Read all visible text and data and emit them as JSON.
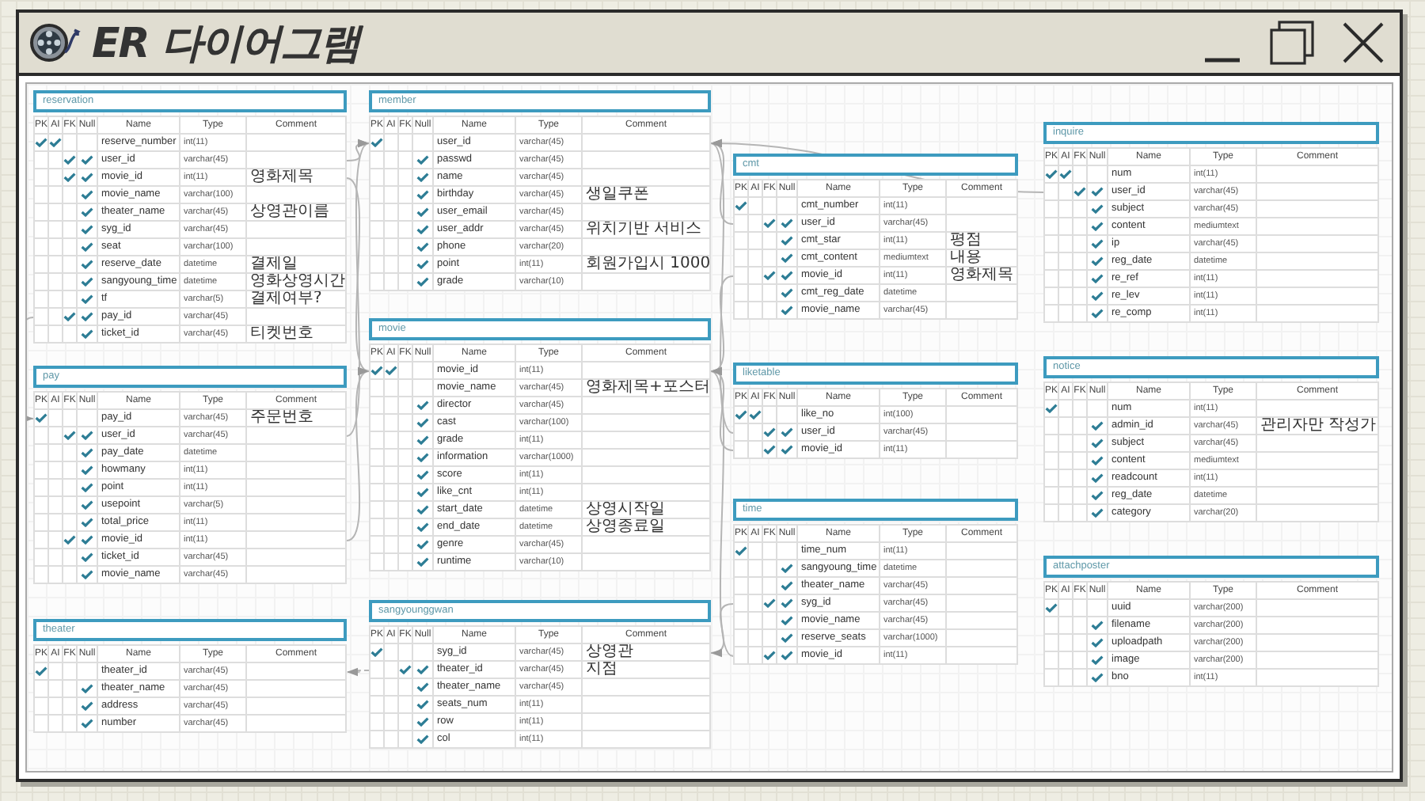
{
  "window": {
    "title": "ER 다이어그램"
  },
  "tables": [
    {
      "name": "reservation",
      "columns": [
        "PK",
        "AI",
        "FK",
        "Null",
        "Name",
        "Type",
        "Comment"
      ],
      "rows": [
        {
          "pk": true,
          "ai": true,
          "fk": false,
          "nn": false,
          "name": "reserve_number",
          "type": "int(11)"
        },
        {
          "pk": false,
          "ai": false,
          "fk": true,
          "nn": true,
          "name": "user_id",
          "type": "varchar(45)"
        },
        {
          "pk": false,
          "ai": false,
          "fk": true,
          "nn": true,
          "name": "movie_id",
          "type": "int(11)",
          "comment": "영화제목"
        },
        {
          "pk": false,
          "ai": false,
          "fk": false,
          "nn": true,
          "name": "movie_name",
          "type": "varchar(100)"
        },
        {
          "pk": false,
          "ai": false,
          "fk": false,
          "nn": true,
          "name": "theater_name",
          "type": "varchar(45)",
          "comment": "상영관이름"
        },
        {
          "pk": false,
          "ai": false,
          "fk": false,
          "nn": true,
          "name": "syg_id",
          "type": "varchar(45)"
        },
        {
          "pk": false,
          "ai": false,
          "fk": false,
          "nn": true,
          "name": "seat",
          "type": "varchar(100)"
        },
        {
          "pk": false,
          "ai": false,
          "fk": false,
          "nn": true,
          "name": "reserve_date",
          "type": "datetime",
          "comment": "결제일"
        },
        {
          "pk": false,
          "ai": false,
          "fk": false,
          "nn": true,
          "name": "sangyoung_time",
          "type": "datetime",
          "comment": "영화상영시간"
        },
        {
          "pk": false,
          "ai": false,
          "fk": false,
          "nn": true,
          "name": "tf",
          "type": "varchar(5)",
          "comment": "결제여부?"
        },
        {
          "pk": false,
          "ai": false,
          "fk": true,
          "nn": true,
          "name": "pay_id",
          "type": "varchar(45)"
        },
        {
          "pk": false,
          "ai": false,
          "fk": false,
          "nn": true,
          "name": "ticket_id",
          "type": "varchar(45)",
          "comment": "티켓번호"
        }
      ]
    },
    {
      "name": "pay",
      "columns": [
        "PK",
        "AI",
        "FK",
        "Null",
        "Name",
        "Type",
        "Comment"
      ],
      "rows": [
        {
          "pk": true,
          "ai": false,
          "fk": false,
          "nn": false,
          "name": "pay_id",
          "type": "varchar(45)",
          "comment": "주문번호"
        },
        {
          "pk": false,
          "ai": false,
          "fk": true,
          "nn": true,
          "name": "user_id",
          "type": "varchar(45)"
        },
        {
          "pk": false,
          "ai": false,
          "fk": false,
          "nn": true,
          "name": "pay_date",
          "type": "datetime"
        },
        {
          "pk": false,
          "ai": false,
          "fk": false,
          "nn": true,
          "name": "howmany",
          "type": "int(11)"
        },
        {
          "pk": false,
          "ai": false,
          "fk": false,
          "nn": true,
          "name": "point",
          "type": "int(11)"
        },
        {
          "pk": false,
          "ai": false,
          "fk": false,
          "nn": true,
          "name": "usepoint",
          "type": "varchar(5)"
        },
        {
          "pk": false,
          "ai": false,
          "fk": false,
          "nn": true,
          "name": "total_price",
          "type": "int(11)"
        },
        {
          "pk": false,
          "ai": false,
          "fk": true,
          "nn": true,
          "name": "movie_id",
          "type": "int(11)"
        },
        {
          "pk": false,
          "ai": false,
          "fk": false,
          "nn": true,
          "name": "ticket_id",
          "type": "varchar(45)"
        },
        {
          "pk": false,
          "ai": false,
          "fk": false,
          "nn": true,
          "name": "movie_name",
          "type": "varchar(45)"
        }
      ]
    },
    {
      "name": "theater",
      "columns": [
        "PK",
        "AI",
        "FK",
        "Null",
        "Name",
        "Type",
        "Comment"
      ],
      "rows": [
        {
          "pk": true,
          "ai": false,
          "fk": false,
          "nn": false,
          "name": "theater_id",
          "type": "varchar(45)"
        },
        {
          "pk": false,
          "ai": false,
          "fk": false,
          "nn": true,
          "name": "theater_name",
          "type": "varchar(45)"
        },
        {
          "pk": false,
          "ai": false,
          "fk": false,
          "nn": true,
          "name": "address",
          "type": "varchar(45)"
        },
        {
          "pk": false,
          "ai": false,
          "fk": false,
          "nn": true,
          "name": "number",
          "type": "varchar(45)"
        }
      ]
    },
    {
      "name": "member",
      "columns": [
        "PK",
        "AI",
        "FK",
        "Null",
        "Name",
        "Type",
        "Comment"
      ],
      "rows": [
        {
          "pk": true,
          "ai": false,
          "fk": false,
          "nn": false,
          "name": "user_id",
          "type": "varchar(45)"
        },
        {
          "pk": false,
          "ai": false,
          "fk": false,
          "nn": true,
          "name": "passwd",
          "type": "varchar(45)"
        },
        {
          "pk": false,
          "ai": false,
          "fk": false,
          "nn": true,
          "name": "name",
          "type": "varchar(45)"
        },
        {
          "pk": false,
          "ai": false,
          "fk": false,
          "nn": true,
          "name": "birthday",
          "type": "varchar(45)",
          "comment": "생일쿠폰"
        },
        {
          "pk": false,
          "ai": false,
          "fk": false,
          "nn": true,
          "name": "user_email",
          "type": "varchar(45)"
        },
        {
          "pk": false,
          "ai": false,
          "fk": false,
          "nn": true,
          "name": "user_addr",
          "type": "varchar(45)",
          "comment": "위치기반 서비스"
        },
        {
          "pk": false,
          "ai": false,
          "fk": false,
          "nn": true,
          "name": "phone",
          "type": "varchar(20)"
        },
        {
          "pk": false,
          "ai": false,
          "fk": false,
          "nn": true,
          "name": "point",
          "type": "int(11)",
          "comment": "회원가입시 1000"
        },
        {
          "pk": false,
          "ai": false,
          "fk": false,
          "nn": true,
          "name": "grade",
          "type": "varchar(10)"
        }
      ]
    },
    {
      "name": "movie",
      "columns": [
        "PK",
        "AI",
        "FK",
        "Null",
        "Name",
        "Type",
        "Comment"
      ],
      "rows": [
        {
          "pk": true,
          "ai": true,
          "fk": false,
          "nn": false,
          "name": "movie_id",
          "type": "int(11)"
        },
        {
          "pk": false,
          "ai": false,
          "fk": false,
          "nn": false,
          "name": "movie_name",
          "type": "varchar(45)",
          "comment": "영화제목+포스터"
        },
        {
          "pk": false,
          "ai": false,
          "fk": false,
          "nn": true,
          "name": "director",
          "type": "varchar(45)"
        },
        {
          "pk": false,
          "ai": false,
          "fk": false,
          "nn": true,
          "name": "cast",
          "type": "varchar(100)"
        },
        {
          "pk": false,
          "ai": false,
          "fk": false,
          "nn": true,
          "name": "grade",
          "type": "int(11)"
        },
        {
          "pk": false,
          "ai": false,
          "fk": false,
          "nn": true,
          "name": "information",
          "type": "varchar(1000)"
        },
        {
          "pk": false,
          "ai": false,
          "fk": false,
          "nn": true,
          "name": "score",
          "type": "int(11)"
        },
        {
          "pk": false,
          "ai": false,
          "fk": false,
          "nn": true,
          "name": "like_cnt",
          "type": "int(11)"
        },
        {
          "pk": false,
          "ai": false,
          "fk": false,
          "nn": true,
          "name": "start_date",
          "type": "datetime",
          "comment": "상영시작일"
        },
        {
          "pk": false,
          "ai": false,
          "fk": false,
          "nn": true,
          "name": "end_date",
          "type": "datetime",
          "comment": "상영종료일"
        },
        {
          "pk": false,
          "ai": false,
          "fk": false,
          "nn": true,
          "name": "genre",
          "type": "varchar(45)"
        },
        {
          "pk": false,
          "ai": false,
          "fk": false,
          "nn": true,
          "name": "runtime",
          "type": "varchar(10)"
        }
      ]
    },
    {
      "name": "sangyounggwan",
      "columns": [
        "PK",
        "AI",
        "FK",
        "Null",
        "Name",
        "Type",
        "Comment"
      ],
      "rows": [
        {
          "pk": true,
          "ai": false,
          "fk": false,
          "nn": false,
          "name": "syg_id",
          "type": "varchar(45)",
          "comment": "상영관"
        },
        {
          "pk": false,
          "ai": false,
          "fk": true,
          "nn": true,
          "name": "theater_id",
          "type": "varchar(45)",
          "comment": "지점"
        },
        {
          "pk": false,
          "ai": false,
          "fk": false,
          "nn": true,
          "name": "theater_name",
          "type": "varchar(45)"
        },
        {
          "pk": false,
          "ai": false,
          "fk": false,
          "nn": true,
          "name": "seats_num",
          "type": "int(11)"
        },
        {
          "pk": false,
          "ai": false,
          "fk": false,
          "nn": true,
          "name": "row",
          "type": "int(11)"
        },
        {
          "pk": false,
          "ai": false,
          "fk": false,
          "nn": true,
          "name": "col",
          "type": "int(11)"
        }
      ]
    },
    {
      "name": "cmt",
      "columns": [
        "PK",
        "AI",
        "FK",
        "Null",
        "Name",
        "Type",
        "Comment"
      ],
      "rows": [
        {
          "pk": true,
          "ai": false,
          "fk": false,
          "nn": false,
          "name": "cmt_number",
          "type": "int(11)"
        },
        {
          "pk": false,
          "ai": false,
          "fk": true,
          "nn": true,
          "name": "user_id",
          "type": "varchar(45)"
        },
        {
          "pk": false,
          "ai": false,
          "fk": false,
          "nn": true,
          "name": "cmt_star",
          "type": "int(11)",
          "comment": "평점"
        },
        {
          "pk": false,
          "ai": false,
          "fk": false,
          "nn": true,
          "name": "cmt_content",
          "type": "mediumtext",
          "comment": "내용"
        },
        {
          "pk": false,
          "ai": false,
          "fk": true,
          "nn": true,
          "name": "movie_id",
          "type": "int(11)",
          "comment": "영화제목"
        },
        {
          "pk": false,
          "ai": false,
          "fk": false,
          "nn": true,
          "name": "cmt_reg_date",
          "type": "datetime"
        },
        {
          "pk": false,
          "ai": false,
          "fk": false,
          "nn": true,
          "name": "movie_name",
          "type": "varchar(45)"
        }
      ]
    },
    {
      "name": "liketable",
      "columns": [
        "PK",
        "AI",
        "FK",
        "Null",
        "Name",
        "Type",
        "Comment"
      ],
      "rows": [
        {
          "pk": true,
          "ai": true,
          "fk": false,
          "nn": false,
          "name": "like_no",
          "type": "int(100)"
        },
        {
          "pk": false,
          "ai": false,
          "fk": true,
          "nn": true,
          "name": "user_id",
          "type": "varchar(45)"
        },
        {
          "pk": false,
          "ai": false,
          "fk": true,
          "nn": true,
          "name": "movie_id",
          "type": "int(11)"
        }
      ]
    },
    {
      "name": "time",
      "columns": [
        "PK",
        "AI",
        "FK",
        "Null",
        "Name",
        "Type",
        "Comment"
      ],
      "rows": [
        {
          "pk": true,
          "ai": false,
          "fk": false,
          "nn": false,
          "name": "time_num",
          "type": "int(11)"
        },
        {
          "pk": false,
          "ai": false,
          "fk": false,
          "nn": true,
          "name": "sangyoung_time",
          "type": "datetime"
        },
        {
          "pk": false,
          "ai": false,
          "fk": false,
          "nn": true,
          "name": "theater_name",
          "type": "varchar(45)"
        },
        {
          "pk": false,
          "ai": false,
          "fk": true,
          "nn": true,
          "name": "syg_id",
          "type": "varchar(45)"
        },
        {
          "pk": false,
          "ai": false,
          "fk": false,
          "nn": true,
          "name": "movie_name",
          "type": "varchar(45)"
        },
        {
          "pk": false,
          "ai": false,
          "fk": false,
          "nn": true,
          "name": "reserve_seats",
          "type": "varchar(1000)"
        },
        {
          "pk": false,
          "ai": false,
          "fk": true,
          "nn": true,
          "name": "movie_id",
          "type": "int(11)"
        }
      ]
    },
    {
      "name": "inquire",
      "columns": [
        "PK",
        "AI",
        "FK",
        "Null",
        "Name",
        "Type",
        "Comment"
      ],
      "rows": [
        {
          "pk": true,
          "ai": true,
          "fk": false,
          "nn": false,
          "name": "num",
          "type": "int(11)"
        },
        {
          "pk": false,
          "ai": false,
          "fk": true,
          "nn": true,
          "name": "user_id",
          "type": "varchar(45)"
        },
        {
          "pk": false,
          "ai": false,
          "fk": false,
          "nn": true,
          "name": "subject",
          "type": "varchar(45)"
        },
        {
          "pk": false,
          "ai": false,
          "fk": false,
          "nn": true,
          "name": "content",
          "type": "mediumtext"
        },
        {
          "pk": false,
          "ai": false,
          "fk": false,
          "nn": true,
          "name": "ip",
          "type": "varchar(45)"
        },
        {
          "pk": false,
          "ai": false,
          "fk": false,
          "nn": true,
          "name": "reg_date",
          "type": "datetime"
        },
        {
          "pk": false,
          "ai": false,
          "fk": false,
          "nn": true,
          "name": "re_ref",
          "type": "int(11)"
        },
        {
          "pk": false,
          "ai": false,
          "fk": false,
          "nn": true,
          "name": "re_lev",
          "type": "int(11)"
        },
        {
          "pk": false,
          "ai": false,
          "fk": false,
          "nn": true,
          "name": "re_comp",
          "type": "int(11)"
        }
      ]
    },
    {
      "name": "notice",
      "columns": [
        "PK",
        "AI",
        "FK",
        "Null",
        "Name",
        "Type",
        "Comment"
      ],
      "rows": [
        {
          "pk": true,
          "ai": false,
          "fk": false,
          "nn": false,
          "name": "num",
          "type": "int(11)"
        },
        {
          "pk": false,
          "ai": false,
          "fk": false,
          "nn": true,
          "name": "admin_id",
          "type": "varchar(45)",
          "comment": "관리자만 작성가"
        },
        {
          "pk": false,
          "ai": false,
          "fk": false,
          "nn": true,
          "name": "subject",
          "type": "varchar(45)"
        },
        {
          "pk": false,
          "ai": false,
          "fk": false,
          "nn": true,
          "name": "content",
          "type": "mediumtext"
        },
        {
          "pk": false,
          "ai": false,
          "fk": false,
          "nn": true,
          "name": "readcount",
          "type": "int(11)"
        },
        {
          "pk": false,
          "ai": false,
          "fk": false,
          "nn": true,
          "name": "reg_date",
          "type": "datetime"
        },
        {
          "pk": false,
          "ai": false,
          "fk": false,
          "nn": true,
          "name": "category",
          "type": "varchar(20)"
        }
      ]
    },
    {
      "name": "attachposter",
      "columns": [
        "PK",
        "AI",
        "FK",
        "Null",
        "Name",
        "Type",
        "Comment"
      ],
      "rows": [
        {
          "pk": true,
          "ai": false,
          "fk": false,
          "nn": false,
          "name": "uuid",
          "type": "varchar(200)"
        },
        {
          "pk": false,
          "ai": false,
          "fk": false,
          "nn": true,
          "name": "filename",
          "type": "varchar(200)"
        },
        {
          "pk": false,
          "ai": false,
          "fk": false,
          "nn": true,
          "name": "uploadpath",
          "type": "varchar(200)"
        },
        {
          "pk": false,
          "ai": false,
          "fk": false,
          "nn": true,
          "name": "image",
          "type": "varchar(200)"
        },
        {
          "pk": false,
          "ai": false,
          "fk": false,
          "nn": true,
          "name": "bno",
          "type": "int(11)"
        }
      ]
    }
  ]
}
